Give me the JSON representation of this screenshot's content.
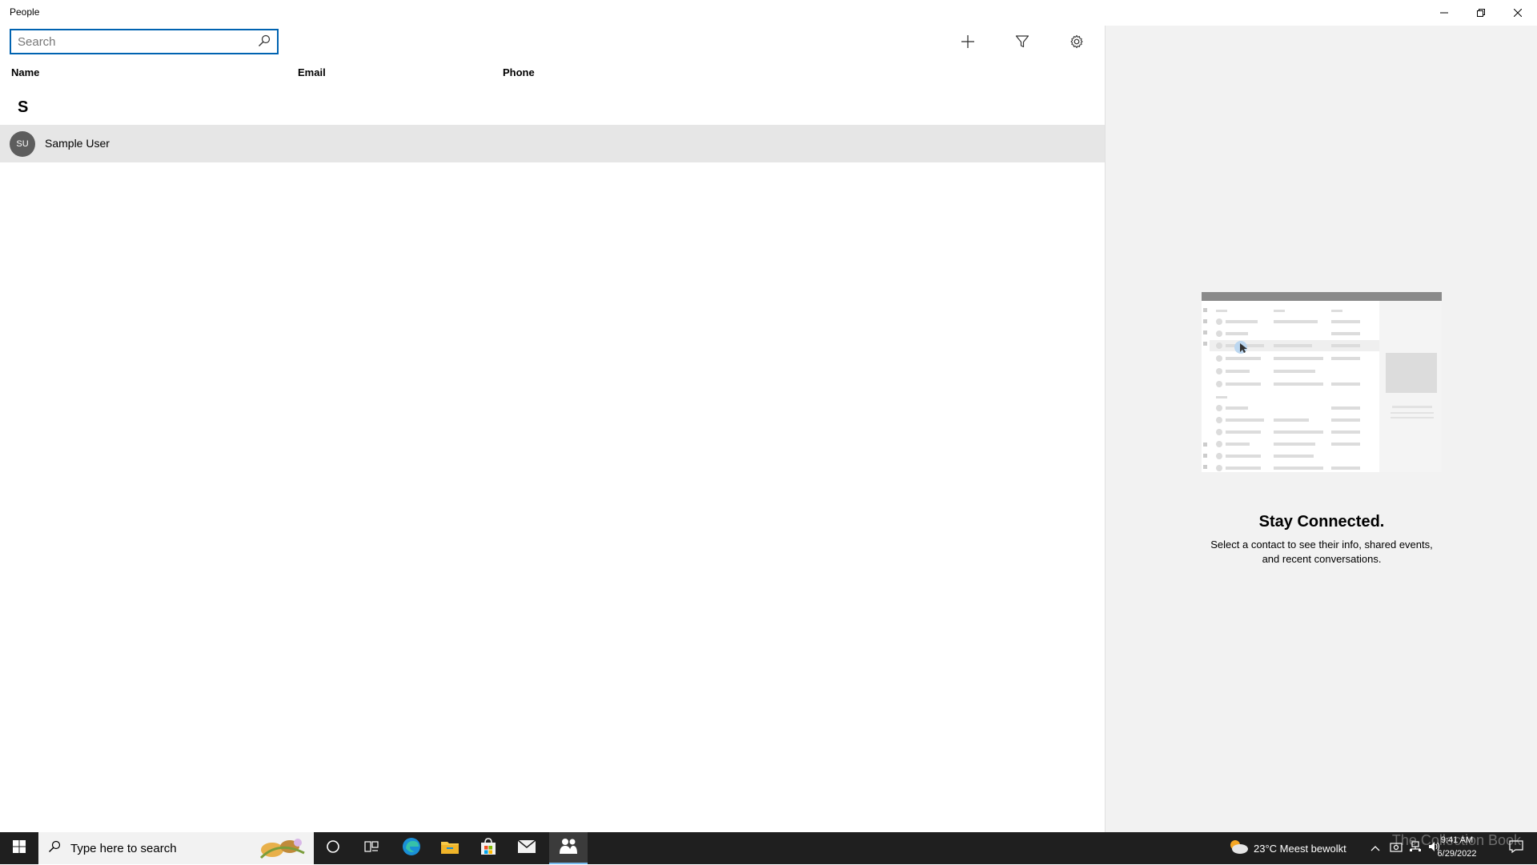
{
  "window": {
    "title": "People",
    "minimize_icon": "minimize-icon",
    "restore_icon": "restore-icon",
    "close_icon": "close-icon"
  },
  "search": {
    "placeholder": "Search",
    "value": ""
  },
  "toolbar": {
    "add_icon": "plus-icon",
    "filter_icon": "filter-icon",
    "settings_icon": "gear-icon"
  },
  "columns": [
    "Name",
    "Email",
    "Phone"
  ],
  "groups": [
    {
      "letter": "S",
      "contacts": [
        {
          "initials": "SU",
          "name": "Sample User",
          "email": "",
          "phone": ""
        }
      ]
    }
  ],
  "details": {
    "title": "Stay Connected.",
    "description": "Select a contact to see their info, shared events, and recent conversations."
  },
  "taskbar": {
    "search_placeholder": "Type here to search",
    "weather": "23°C  Meest bewolkt",
    "time": "9:41 AM",
    "date": "6/29/2022",
    "watermark": "The Collection Book",
    "accent": "#76b9ed"
  }
}
